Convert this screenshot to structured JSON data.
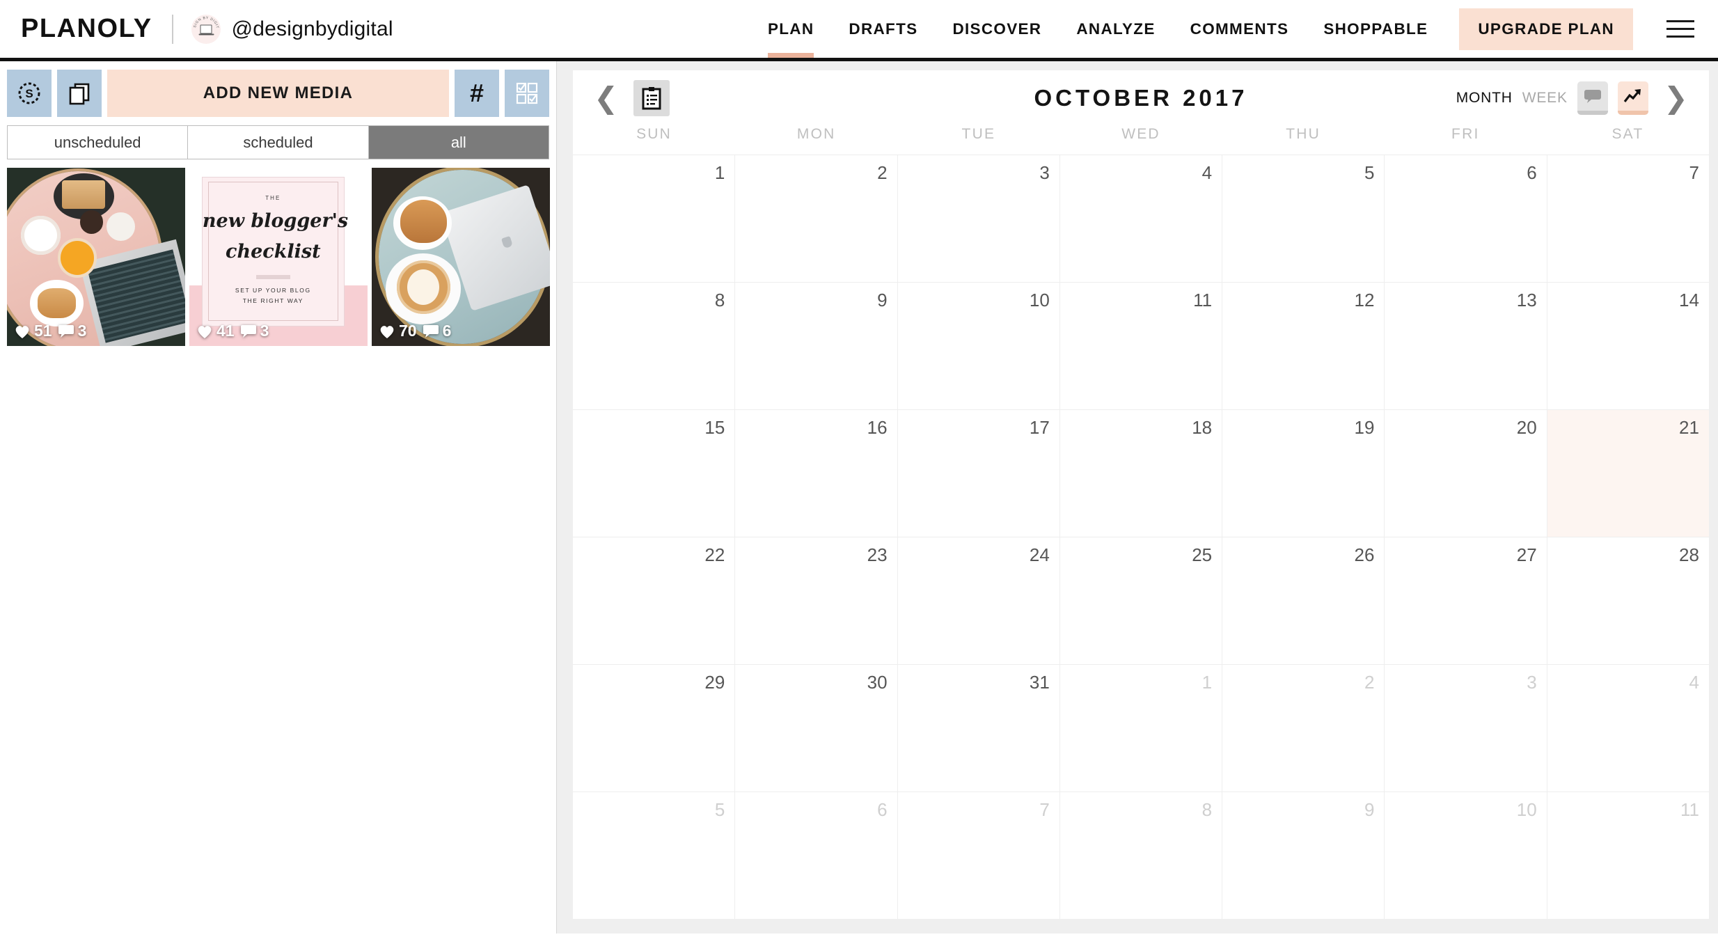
{
  "header": {
    "brand": "PLANOLY",
    "handle": "@designbydigital",
    "avatar_ring_text": "DESIGN BY DIGITAL",
    "nav": [
      {
        "label": "PLAN",
        "active": true
      },
      {
        "label": "DRAFTS",
        "active": false
      },
      {
        "label": "DISCOVER",
        "active": false
      },
      {
        "label": "ANALYZE",
        "active": false
      },
      {
        "label": "COMMENTS",
        "active": false
      },
      {
        "label": "SHOPPABLE",
        "active": false
      }
    ],
    "upgrade_label": "UPGRADE PLAN",
    "menu_icon": "hamburger-menu-icon",
    "accent_color": "#eab29b",
    "upgrade_bg": "#fae0d2"
  },
  "left_panel": {
    "toolbar": {
      "stories_icon": "stories-circle-s-icon",
      "multipost_icon": "layered-squares-icon",
      "add_media_label": "ADD NEW MEDIA",
      "hashtag_icon": "hashtag-icon",
      "grid_select_icon": "grid-checkbox-select-icon",
      "tool_bg": "#b3cade",
      "add_media_bg": "#fae0d2"
    },
    "filters": [
      {
        "label": "unscheduled",
        "active": false
      },
      {
        "label": "scheduled",
        "active": false
      },
      {
        "label": "all",
        "active": true
      }
    ],
    "media": [
      {
        "id": "thumb1",
        "alt": "pink table breakfast flatlay with laptop",
        "likes": "51",
        "comments": "3"
      },
      {
        "id": "thumb2",
        "alt": "new blogger's checklist graphic",
        "likes": "41",
        "comments": "3",
        "text": {
          "eyebrow": "THE",
          "line1": "new blogger's",
          "line2": "checklist",
          "sub1": "SET UP YOUR BLOG",
          "sub2": "THE RIGHT WAY"
        }
      },
      {
        "id": "thumb3",
        "alt": "teal table with croissant latte and laptop",
        "likes": "70",
        "comments": "6"
      }
    ]
  },
  "calendar": {
    "prev_icon": "chevron-left-icon",
    "next_icon": "chevron-right-icon",
    "clipboard_icon": "clipboard-list-icon",
    "title": "OCTOBER 2017",
    "view_month": "MONTH",
    "view_week": "WEEK",
    "active_view": "MONTH",
    "comments_icon": "speech-bubble-icon",
    "analytics_icon": "trend-arrow-icon",
    "weekdays": [
      "SUN",
      "MON",
      "TUE",
      "WED",
      "THU",
      "FRI",
      "SAT"
    ],
    "today": 21,
    "today_bg": "#fdf5f1",
    "weeks": [
      [
        {
          "d": "1",
          "m": false
        },
        {
          "d": "2",
          "m": false
        },
        {
          "d": "3",
          "m": false
        },
        {
          "d": "4",
          "m": false
        },
        {
          "d": "5",
          "m": false
        },
        {
          "d": "6",
          "m": false
        },
        {
          "d": "7",
          "m": false
        }
      ],
      [
        {
          "d": "8",
          "m": false
        },
        {
          "d": "9",
          "m": false
        },
        {
          "d": "10",
          "m": false
        },
        {
          "d": "11",
          "m": false
        },
        {
          "d": "12",
          "m": false
        },
        {
          "d": "13",
          "m": false
        },
        {
          "d": "14",
          "m": false
        }
      ],
      [
        {
          "d": "15",
          "m": false
        },
        {
          "d": "16",
          "m": false
        },
        {
          "d": "17",
          "m": false
        },
        {
          "d": "18",
          "m": false
        },
        {
          "d": "19",
          "m": false
        },
        {
          "d": "20",
          "m": false
        },
        {
          "d": "21",
          "m": false,
          "today": true
        }
      ],
      [
        {
          "d": "22",
          "m": false
        },
        {
          "d": "23",
          "m": false
        },
        {
          "d": "24",
          "m": false
        },
        {
          "d": "25",
          "m": false
        },
        {
          "d": "26",
          "m": false
        },
        {
          "d": "27",
          "m": false
        },
        {
          "d": "28",
          "m": false
        }
      ],
      [
        {
          "d": "29",
          "m": false
        },
        {
          "d": "30",
          "m": false
        },
        {
          "d": "31",
          "m": false
        },
        {
          "d": "1",
          "m": true
        },
        {
          "d": "2",
          "m": true
        },
        {
          "d": "3",
          "m": true
        },
        {
          "d": "4",
          "m": true
        }
      ],
      [
        {
          "d": "5",
          "m": true
        },
        {
          "d": "6",
          "m": true
        },
        {
          "d": "7",
          "m": true
        },
        {
          "d": "8",
          "m": true
        },
        {
          "d": "9",
          "m": true
        },
        {
          "d": "10",
          "m": true
        },
        {
          "d": "11",
          "m": true
        }
      ]
    ]
  }
}
